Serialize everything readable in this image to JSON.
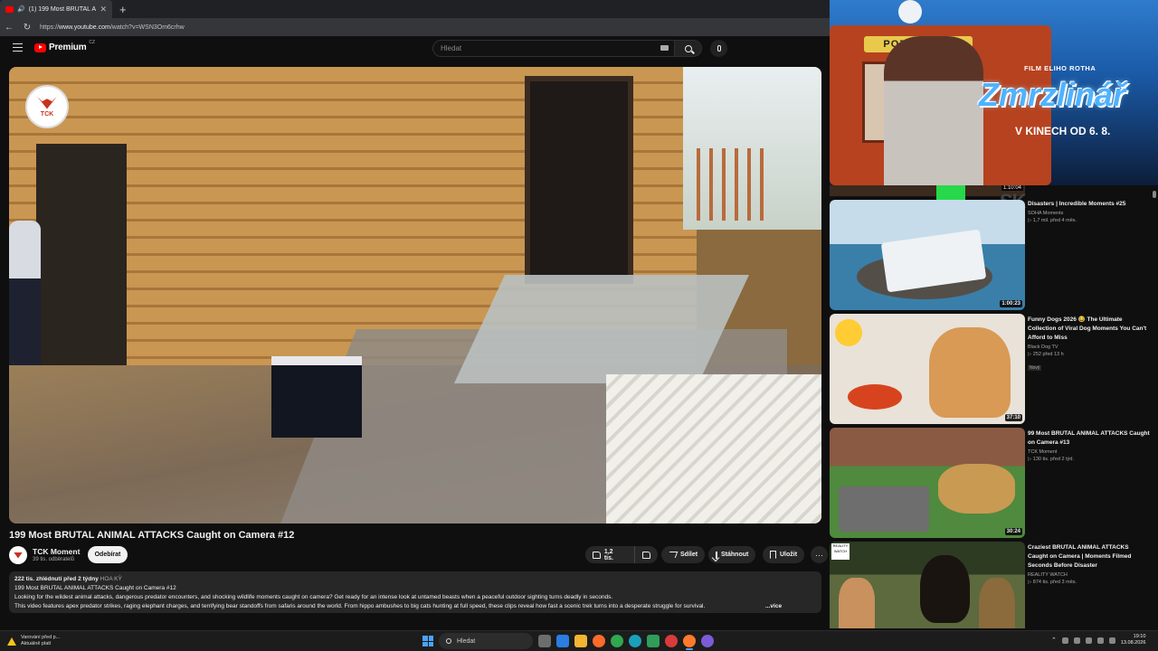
{
  "browser": {
    "tab_title": "(1) 199 Most BRUTAL ANIMA",
    "tab_close": "✕",
    "new_tab": "+",
    "url_prefix": "https://",
    "url_host": "www.youtube.com",
    "url_path": "/watch?v=WSN3Om6crhw"
  },
  "youtube": {
    "logo_text": "Premium",
    "logo_region": "CZ",
    "search_placeholder": "Hledat"
  },
  "video": {
    "title": "199 Most BRUTAL ANIMAL ATTACKS Caught on Camera #12",
    "channel_badge": "TCK",
    "channel": "TCK Moment",
    "subscribers": "39 tis. odběratelů",
    "subscribe_label": "Odebírat",
    "likes": "1,2 tis.",
    "share_label": "Sdílet",
    "download_label": "Stáhnout",
    "save_label": "Uložit",
    "more_label": "···"
  },
  "description": {
    "meta": "222 tis. zhlédnutí  před 2 týdny",
    "tag": "HOA KỲ",
    "line1": "199 Most BRUTAL ANIMAL ATTACKS Caught on Camera #12",
    "line2": "Looking for the wildest animal attacks, dangerous predator encounters, and shocking wildlife moments caught on camera? Get ready for an intense look at untamed beasts when a peaceful outdoor sighting turns deadly in seconds.",
    "line3": "This video features apex predator strikes, raging elephant charges, and terrifying bear standoffs from safaris around the world. From hippo ambushes to big cats hunting at full speed, these clips reveal how fast a scenic trek turns into a desperate struggle for survival.",
    "more": "...více"
  },
  "ad": {
    "sign": "POZOR DĚTI",
    "subtitle": "FILM ELIHO ROTHA",
    "title": "Zmrzlinář",
    "date": "V KINECH OD 6. 8."
  },
  "related": {
    "top_strip_duration": "1:10:04",
    "top_strip_text": "SK",
    "items": [
      {
        "title": "Disasters | Incredible Moments #25",
        "channel": "SOHA Moments",
        "stats": "▷ 1,7 mil.  před 4 měs.",
        "duration": "1:00:23"
      },
      {
        "title": "Funny Dogs 2026 😂 The Ultimate Collection of Viral Dog Moments You Can't Afford to Miss",
        "channel": "Black Dog TV",
        "stats": "▷ 252  před 13 h",
        "badge": "Nový",
        "duration": "37:10"
      },
      {
        "title": "99 Most BRUTAL ANIMAL ATTACKS Caught on Camera #13",
        "channel": "TCK Moment",
        "stats": "▷ 130 tis.  před 2 týd.",
        "duration": "30:24"
      },
      {
        "title": "Craziest BRUTAL ANIMAL ATTACKS Caught on Camera | Moments Filmed Seconds Before Disaster",
        "channel": "REALITY WATCH",
        "stats": "▷ 874 tis.  před 3 měs.",
        "thumb_logo": "REALITY WATCH"
      }
    ]
  },
  "taskbar": {
    "warning_title": "Varování před p...",
    "warning_sub": "Aktuálně platí",
    "search_label": "Hledat",
    "time": "19:10",
    "date": "13.08.2026"
  },
  "colors": {
    "yt_red": "#ff0000",
    "bg": "#0f0f0f",
    "pill": "#272727"
  }
}
